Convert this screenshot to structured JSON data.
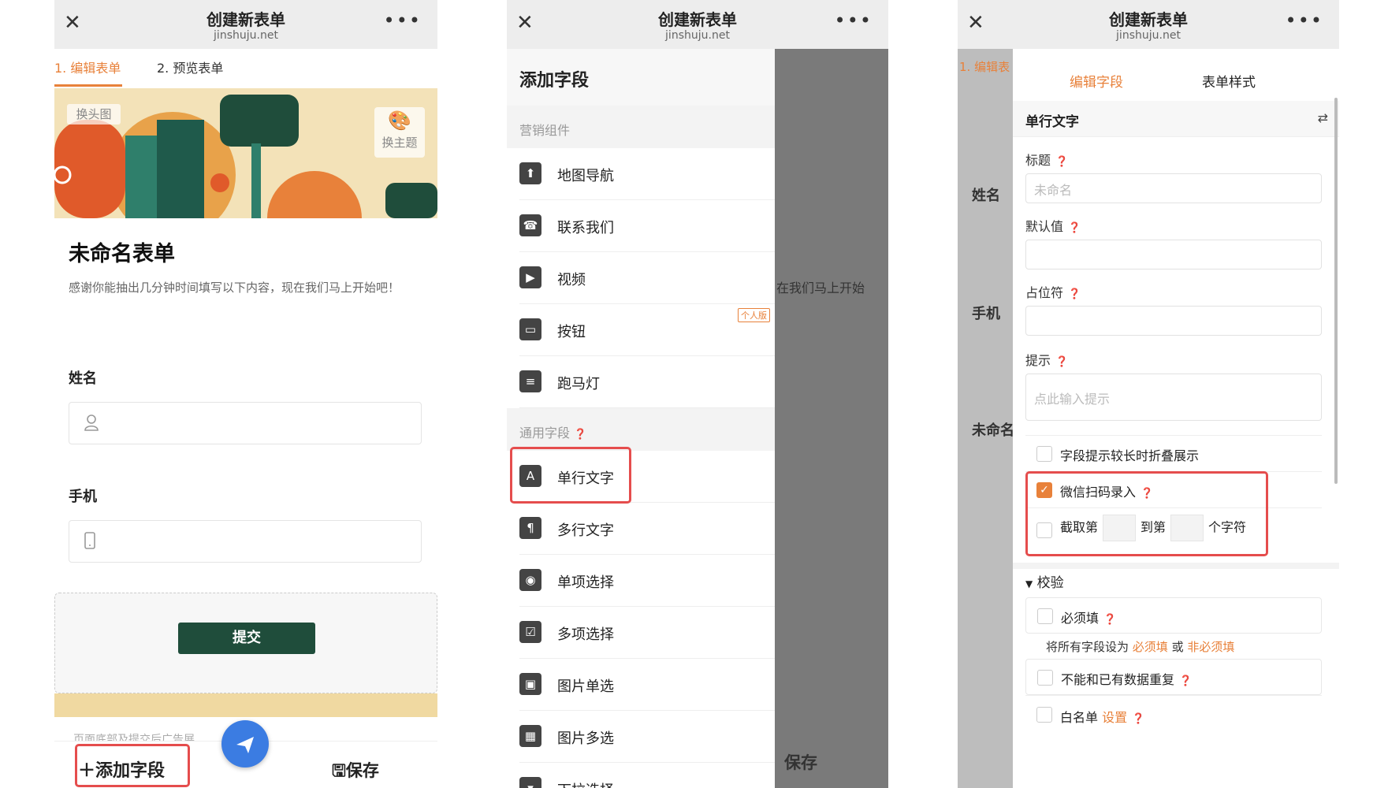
{
  "app": {
    "title": "创建新表单",
    "url": "jinshuju.net"
  },
  "editor": {
    "steps": [
      "1. 编辑表单",
      "2. 预览表单"
    ],
    "banner": {
      "change_header": "换头图",
      "change_theme": "换主题"
    },
    "form_title": "未命名表单",
    "form_desc": "感谢你能抽出几分钟时间填写以下内容，现在我们马上开始吧！",
    "fields": [
      {
        "label": "姓名"
      },
      {
        "label": "手机"
      }
    ],
    "submit": "提交",
    "ad_text": "页面底部及提交后广告展",
    "add_field": "添加字段",
    "save": "保存"
  },
  "drawer": {
    "title": "添加字段",
    "sections": [
      {
        "name": "营销组件",
        "items": [
          {
            "label": "地图导航",
            "icon": "map-nav-icon"
          },
          {
            "label": "联系我们",
            "icon": "phone-icon"
          },
          {
            "label": "视频",
            "icon": "video-icon"
          },
          {
            "label": "按钮",
            "icon": "button-icon",
            "badge": "个人版"
          },
          {
            "label": "跑马灯",
            "icon": "marquee-icon"
          }
        ]
      },
      {
        "name": "通用字段",
        "items": [
          {
            "label": "单行文字",
            "icon": "text-icon"
          },
          {
            "label": "多行文字",
            "icon": "paragraph-icon"
          },
          {
            "label": "单项选择",
            "icon": "radio-icon"
          },
          {
            "label": "多项选择",
            "icon": "checkbox-icon"
          },
          {
            "label": "图片单选",
            "icon": "image-icon"
          },
          {
            "label": "图片多选",
            "icon": "images-icon"
          },
          {
            "label": "下拉选择",
            "icon": "dropdown-icon"
          }
        ]
      }
    ],
    "bg_text": "在我们马上开始",
    "bg_save": "保存"
  },
  "settings": {
    "tabs": [
      "编辑字段",
      "表单样式"
    ],
    "field_type": "单行文字",
    "bg_step": "1. 编辑表",
    "bg_labels": [
      "姓名",
      "手机",
      "未命名"
    ],
    "props": [
      {
        "label": "标题",
        "placeholder": "未命名"
      },
      {
        "label": "默认值",
        "placeholder": ""
      },
      {
        "label": "占位符",
        "placeholder": ""
      },
      {
        "label": "提示",
        "placeholder": "点此输入提示"
      }
    ],
    "options": {
      "collapse": "字段提示较长时折叠展示",
      "wechat_scan": "微信扫码录入",
      "truncate_a": "截取第",
      "truncate_b": "到第",
      "truncate_c": "个字符"
    },
    "validation": {
      "heading": "校验",
      "required": "必须填",
      "set_all_prefix": "将所有字段设为",
      "set_required": "必须填",
      "or": "或",
      "set_optional": "非必须填",
      "no_duplicate": "不能和已有数据重复",
      "whitelist": "白名单",
      "whitelist_setup": "设置"
    }
  },
  "colors": {
    "accent": "#e8813a",
    "highlight": "#e54d4d",
    "submit": "#1f4d3b",
    "fab": "#3b7ce2"
  }
}
